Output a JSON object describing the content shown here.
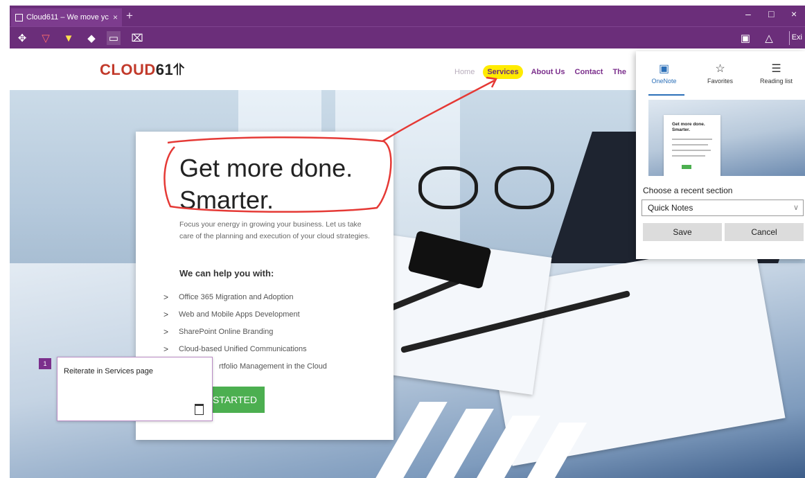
{
  "browser": {
    "tab_title": "Cloud611 – We move yc",
    "tab_close": "×",
    "new_tab": "+",
    "minimize": "–",
    "maximize": "□",
    "close": "×",
    "exit_label": "Exi"
  },
  "ink_toolbar": {
    "tools": [
      "pan-icon",
      "ballpoint-pen-icon",
      "highlighter-icon",
      "eraser-icon",
      "add-note-icon",
      "clip-icon"
    ],
    "right_tools": [
      "save-web-note-icon",
      "share-icon"
    ]
  },
  "site": {
    "logo_text": "CLOUD",
    "logo_num": "61",
    "nav": {
      "home": "Home",
      "services": "Services",
      "about": "About Us",
      "contact": "Contact",
      "partial": "The"
    }
  },
  "hero_card": {
    "headline_1": "Get more done.",
    "headline_2": "Smarter.",
    "lead": "Focus your energy in growing your business. Let us take care of the planning and execution of your cloud strategies.",
    "help_heading": "We can help you with:",
    "services": [
      "Office 365 Migration and Adoption",
      "Web and Mobile Apps Development",
      "SharePoint Online Branding",
      "Cloud-based Unified Communications",
      "rtfolio Management in the Cloud"
    ],
    "cta": "STARTED"
  },
  "comment": {
    "marker": "1",
    "text": "Reiterate in Services page"
  },
  "hub": {
    "tabs": [
      {
        "label": "OneNote",
        "icon": "onenote-icon"
      },
      {
        "label": "Favorites",
        "icon": "star-icon"
      },
      {
        "label": "Reading list",
        "icon": "reading-list-icon"
      }
    ],
    "preview_title": "Get more done. Smarter.",
    "choose_label": "Choose a recent section",
    "section_value": "Quick Notes",
    "save": "Save",
    "cancel": "Cancel"
  },
  "colors": {
    "chrome": "#6b2e7a",
    "ink": "#e53935",
    "highlight": "#ffeb00",
    "cta": "#4caf50"
  }
}
